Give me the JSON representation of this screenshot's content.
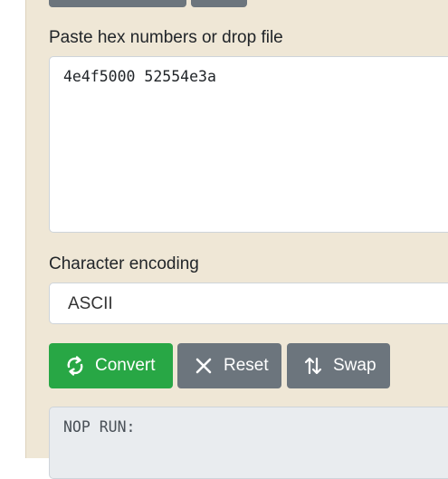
{
  "input_section": {
    "label": "Paste hex numbers or drop file",
    "value": "4e4f5000 52554e3a"
  },
  "encoding_section": {
    "label": "Character encoding",
    "selected": "ASCII"
  },
  "buttons": {
    "convert": {
      "label": "Convert",
      "icon": "refresh-icon",
      "color": "#28a745"
    },
    "reset": {
      "label": "Reset",
      "icon": "close-icon",
      "color": "#6c757d"
    },
    "swap": {
      "label": "Swap",
      "icon": "swap-arrows-icon",
      "color": "#6c757d"
    }
  },
  "output_section": {
    "value": "NOP RUN:"
  },
  "colors": {
    "panel_background": "#efe7d6",
    "output_background": "#e9ecef"
  }
}
